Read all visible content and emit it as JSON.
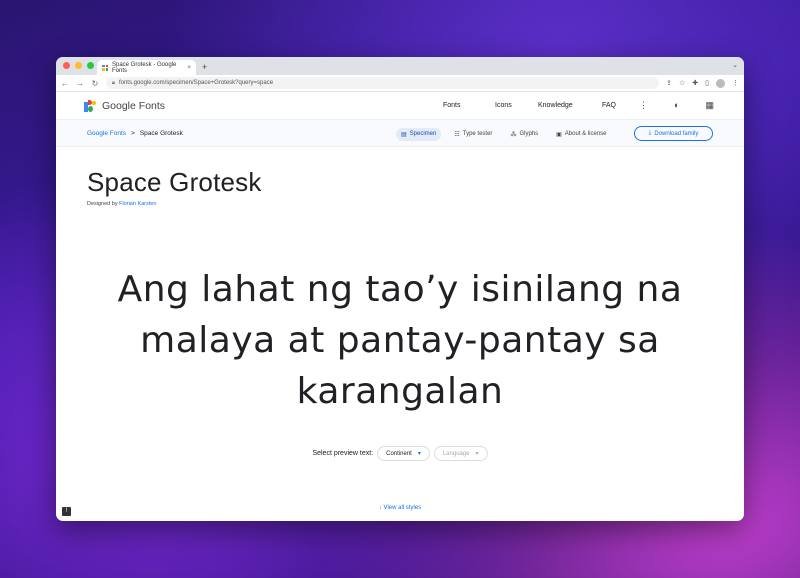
{
  "browser": {
    "tab_title": "Space Grotesk - Google Fonts",
    "tab_close": "×",
    "new_tab": "+",
    "url": "fonts.google.com/specimen/Space+Grotesk?query=space"
  },
  "header": {
    "logo_text": "Google Fonts",
    "nav": [
      "Fonts",
      "Icons",
      "Knowledge",
      "FAQ"
    ]
  },
  "subbar": {
    "breadcrumb_root": "Google Fonts",
    "breadcrumb_sep": ">",
    "breadcrumb_current": "Space Grotesk",
    "tabs": [
      "Specimen",
      "Type tester",
      "Glyphs",
      "About & license"
    ],
    "download_label": "Download family"
  },
  "main": {
    "family_name": "Space Grotesk",
    "designed_by": "Designed by",
    "designer": "Florian Karsten",
    "preview_lines": [
      "Ang lahat ng tao’y isinilang na",
      "malaya at pantay-pantay sa",
      "karangalan"
    ],
    "select_label": "Select preview text:",
    "continent": "Continent",
    "language": "Language",
    "view_all": "View all styles"
  },
  "colors": {
    "accent": "#1a73e8",
    "traffic_red": "#ff5f57",
    "traffic_yellow": "#febc2e",
    "traffic_green": "#28c840"
  }
}
